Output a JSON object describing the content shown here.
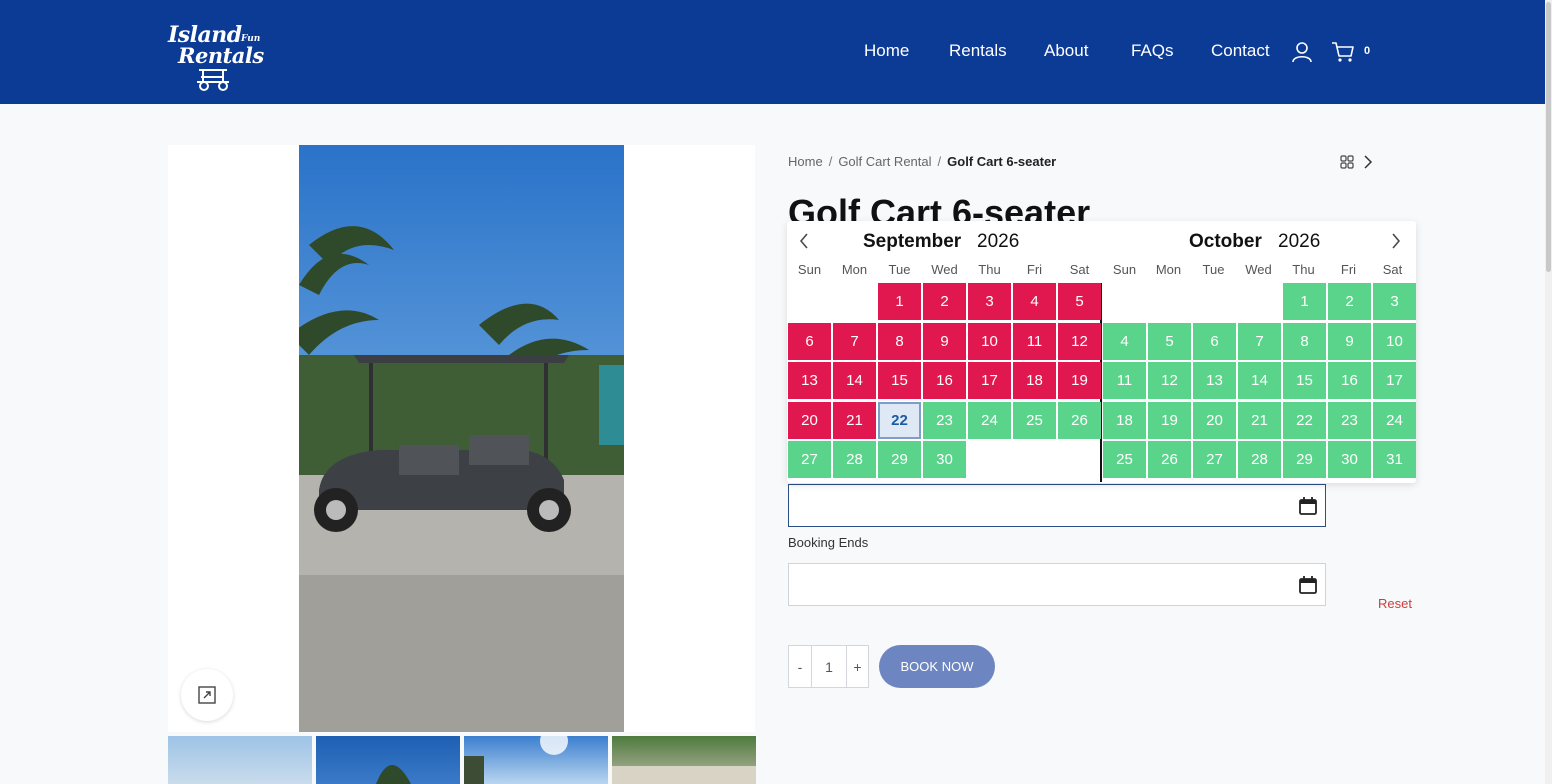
{
  "header": {
    "logo": {
      "line1": "Island",
      "small": "Fun",
      "line2": "Rentals",
      "icon": "golf-cart-icon"
    },
    "nav": [
      {
        "label": "Home"
      },
      {
        "label": "Rentals"
      },
      {
        "label": "About"
      },
      {
        "label": "FAQs"
      },
      {
        "label": "Contact"
      }
    ],
    "account_icon": "user-icon",
    "cart_icon": "cart-icon",
    "cart_count": "0",
    "background": "#0c3b96"
  },
  "breadcrumb": {
    "items": [
      "Home",
      "Golf Cart Rental"
    ],
    "separator": "/",
    "current": "Golf Cart 6-seater"
  },
  "product": {
    "title": "Golf Cart 6-seater"
  },
  "calendar": {
    "left": {
      "month": "September",
      "year": "2026"
    },
    "right": {
      "month": "October",
      "year": "2026"
    },
    "weekdays": [
      "Sun",
      "Mon",
      "Tue",
      "Wed",
      "Thu",
      "Fri",
      "Sat"
    ],
    "september_start_weekday": 2,
    "september_days": 30,
    "september_booked_through": 21,
    "today": 22,
    "october_start_weekday": 4,
    "october_days": 31,
    "colors": {
      "booked": "#e0184f",
      "available": "#5ad48a",
      "today": "#dfe9f5"
    }
  },
  "form": {
    "booking_ends_label": "Booking Ends",
    "reset_label": "Reset",
    "qty_minus": "-",
    "qty_value": "1",
    "qty_plus": "+",
    "book_now": "BOOK NOW"
  }
}
